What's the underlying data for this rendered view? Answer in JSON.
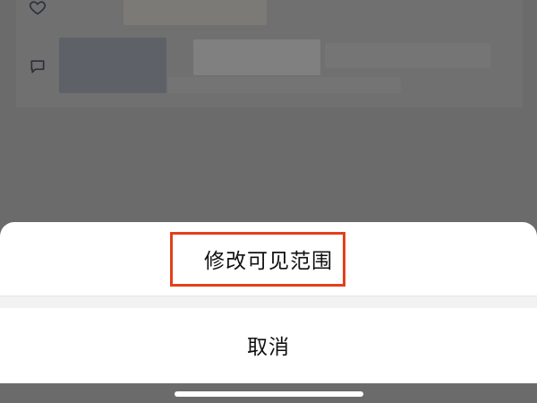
{
  "background_feed": {
    "icons": [
      "heart-icon",
      "comment-icon"
    ]
  },
  "action_sheet": {
    "option_label": "修改可见范围",
    "cancel_label": "取消"
  },
  "colors": {
    "overlay": "#6b6b6b",
    "sheet": "#ffffff",
    "highlight": "#e3401a"
  }
}
